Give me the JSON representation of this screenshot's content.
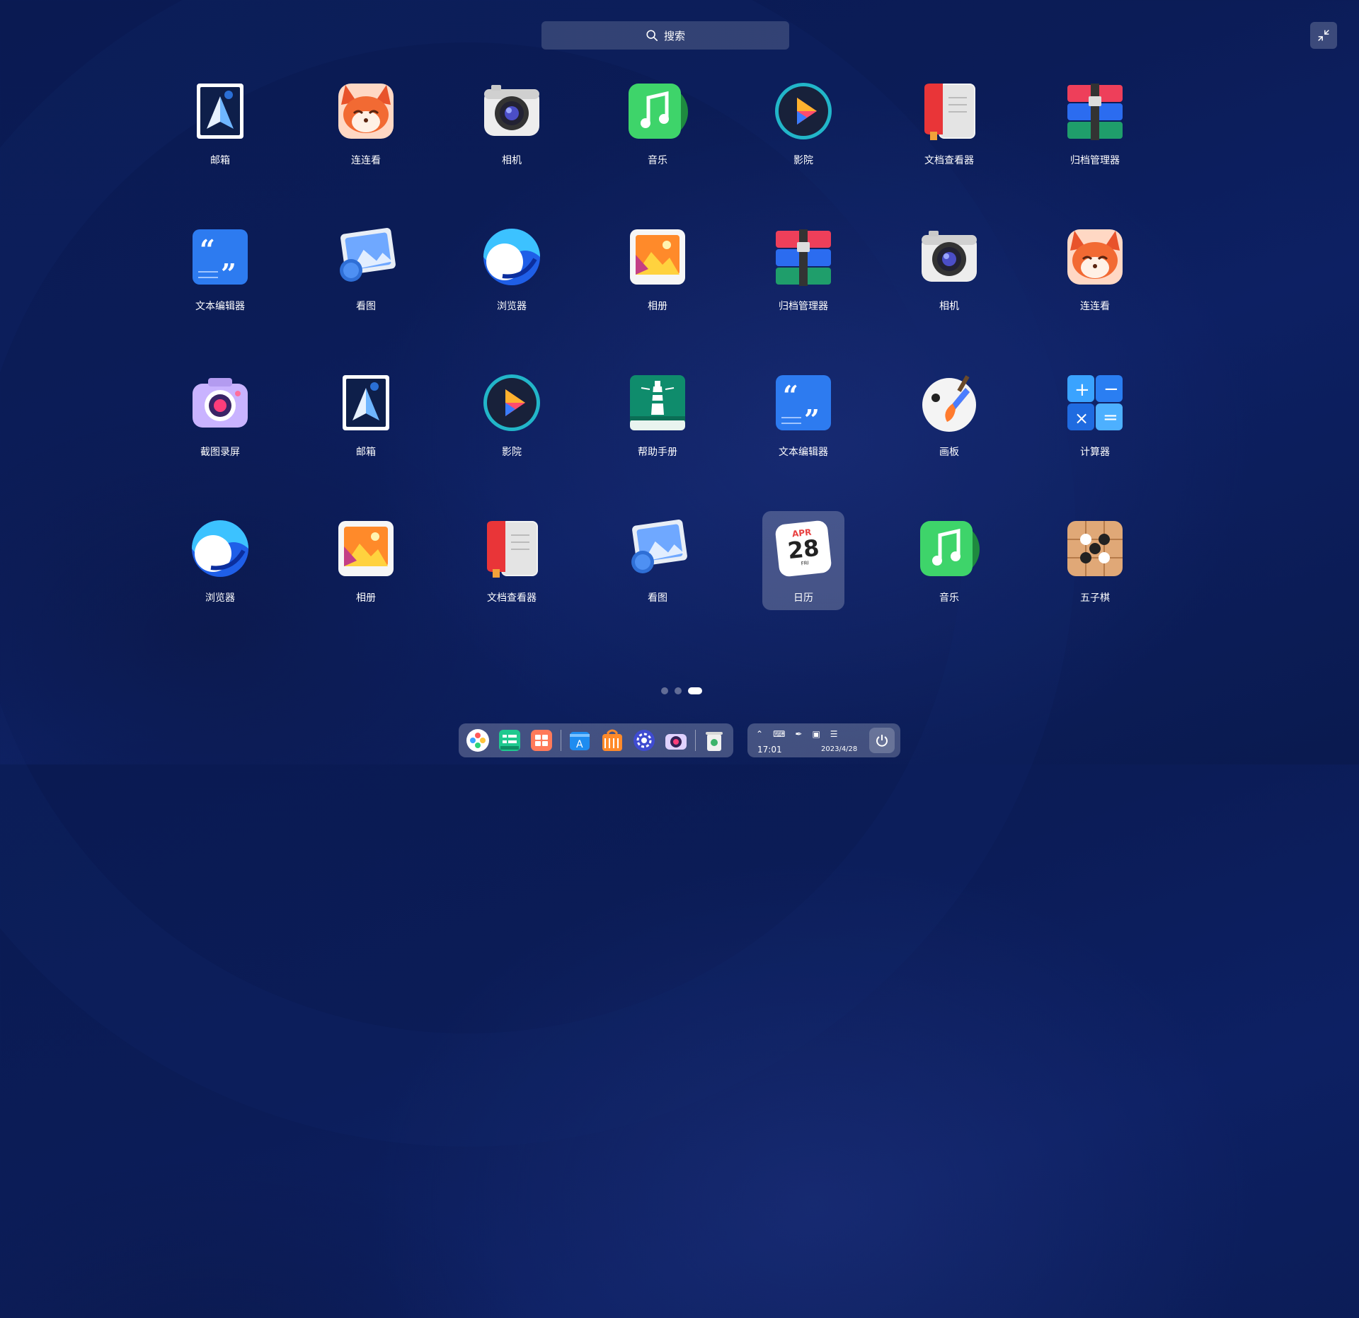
{
  "search": {
    "label": "搜索"
  },
  "apps": [
    {
      "name": "邮箱",
      "icon": "mail-icon"
    },
    {
      "name": "连连看",
      "icon": "fox-game-icon"
    },
    {
      "name": "相机",
      "icon": "camera-icon"
    },
    {
      "name": "音乐",
      "icon": "music-icon"
    },
    {
      "name": "影院",
      "icon": "movie-player-icon"
    },
    {
      "name": "文档查看器",
      "icon": "document-viewer-icon"
    },
    {
      "name": "归档管理器",
      "icon": "archive-manager-icon"
    },
    {
      "name": "文本编辑器",
      "icon": "text-editor-icon"
    },
    {
      "name": "看图",
      "icon": "image-viewer-icon"
    },
    {
      "name": "浏览器",
      "icon": "browser-icon"
    },
    {
      "name": "相册",
      "icon": "album-icon"
    },
    {
      "name": "归档管理器",
      "icon": "archive-manager-icon"
    },
    {
      "name": "相机",
      "icon": "camera-icon"
    },
    {
      "name": "连连看",
      "icon": "fox-game-icon"
    },
    {
      "name": "截图录屏",
      "icon": "screenshot-icon"
    },
    {
      "name": "邮箱",
      "icon": "mail-icon"
    },
    {
      "name": "影院",
      "icon": "movie-player-icon"
    },
    {
      "name": "帮助手册",
      "icon": "help-manual-icon"
    },
    {
      "name": "文本编辑器",
      "icon": "text-editor-icon"
    },
    {
      "name": "画板",
      "icon": "draw-board-icon"
    },
    {
      "name": "计算器",
      "icon": "calculator-icon"
    },
    {
      "name": "浏览器",
      "icon": "browser-icon"
    },
    {
      "name": "相册",
      "icon": "album-icon"
    },
    {
      "name": "文档查看器",
      "icon": "document-viewer-icon"
    },
    {
      "name": "看图",
      "icon": "image-viewer-icon"
    },
    {
      "name": "日历",
      "icon": "calendar-icon",
      "selected": true,
      "month": "APR",
      "day": "28",
      "weekday": "FRI"
    },
    {
      "name": "音乐",
      "icon": "music-icon"
    },
    {
      "name": "五子棋",
      "icon": "gomoku-icon"
    }
  ],
  "pager": {
    "pages": 3,
    "current": 3
  },
  "dock": {
    "items": [
      "launcher-icon",
      "file-manager-icon",
      "multitask-view-icon",
      "app-store-icon",
      "app-store-bag-icon",
      "control-center-icon",
      "camera-icon",
      "trash-icon"
    ]
  },
  "tray": {
    "time": "17:01",
    "date": "2023/4/28"
  }
}
